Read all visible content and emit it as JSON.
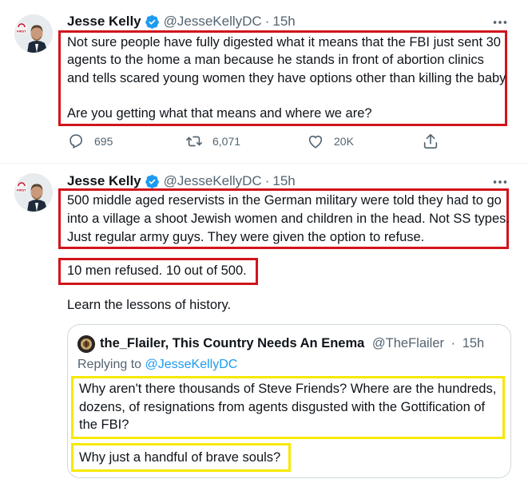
{
  "tweets": [
    {
      "author": "Jesse Kelly",
      "handle": "@JesseKellyDC",
      "time": "15h",
      "lines": [
        "Not sure people have fully digested what it means that the FBI just sent 30",
        "agents to the home a man because he stands in front of abortion clinics",
        "and tells scared young women they have options other than killing the baby",
        "Are you getting what that means and where we are?"
      ],
      "stats": {
        "replies": "695",
        "retweets": "6,071",
        "likes": "20K"
      }
    },
    {
      "author": "Jesse Kelly",
      "handle": "@JesseKellyDC",
      "time": "15h",
      "lines": [
        "500 middle aged reservists in the German military were told they had to go",
        "into a village a shoot Jewish women and children in the head. Not SS types.",
        "Just regular army guys. They were given the option to refuse.",
        "10 men refused. 10 out of 500.",
        "Learn the lessons of history."
      ]
    }
  ],
  "quote": {
    "author": "the_Flailer, This Country Needs An Enema",
    "handle": "@TheFlailer",
    "time": "15h",
    "replying_prefix": "Replying to",
    "replying_to": "@JesseKellyDC",
    "lines": [
      "Why aren't there thousands of Steve Friends? Where are the hundreds,",
      "dozens, of resignations from agents disgusted with the Gottification of",
      "the FBI?",
      "Why just a handful of brave souls?"
    ]
  },
  "separator": "·",
  "avatar_badge": "FIRST",
  "icons": [
    "verified-badge-icon",
    "more-icon",
    "reply-icon",
    "retweet-icon",
    "like-icon",
    "share-icon"
  ],
  "colors": {
    "highlight_red": "#d1141b",
    "highlight_yellow": "#f6e900",
    "verified_blue": "#1d9bf0",
    "muted": "#536471",
    "text": "#0f1419"
  }
}
